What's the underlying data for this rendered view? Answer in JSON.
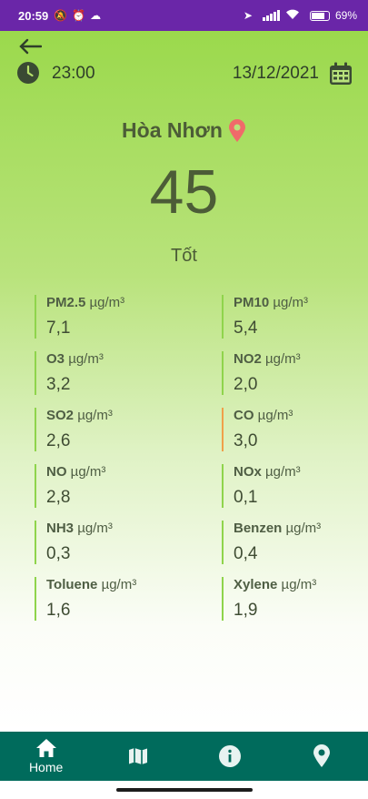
{
  "status_bar": {
    "time": "20:59",
    "battery": "69%"
  },
  "header": {
    "time": "23:00",
    "date": "13/12/2021"
  },
  "location": {
    "name": "Hòa Nhơn"
  },
  "aqi": {
    "value": "45",
    "status": "Tốt"
  },
  "unit": "µg/m³",
  "metrics": [
    {
      "name": "PM2.5",
      "value": "7,1"
    },
    {
      "name": "PM10",
      "value": "5,4"
    },
    {
      "name": "O3",
      "value": "3,2"
    },
    {
      "name": "NO2",
      "value": "2,0"
    },
    {
      "name": "SO2",
      "value": "2,6"
    },
    {
      "name": "CO",
      "value": "3,0"
    },
    {
      "name": "NO",
      "value": "2,8"
    },
    {
      "name": "NOx",
      "value": "0,1"
    },
    {
      "name": "NH3",
      "value": "0,3"
    },
    {
      "name": "Benzen",
      "value": "0,4"
    },
    {
      "name": "Toluene",
      "value": "1,6"
    },
    {
      "name": "Xylene",
      "value": "1,9"
    }
  ],
  "nav": {
    "home_label": "Home"
  },
  "colors": {
    "status_bar": "#6a26a8",
    "nav": "#006b5c",
    "accent": "#8fd44c",
    "warning": "#f0a04a",
    "pin": "#f06a6a"
  }
}
